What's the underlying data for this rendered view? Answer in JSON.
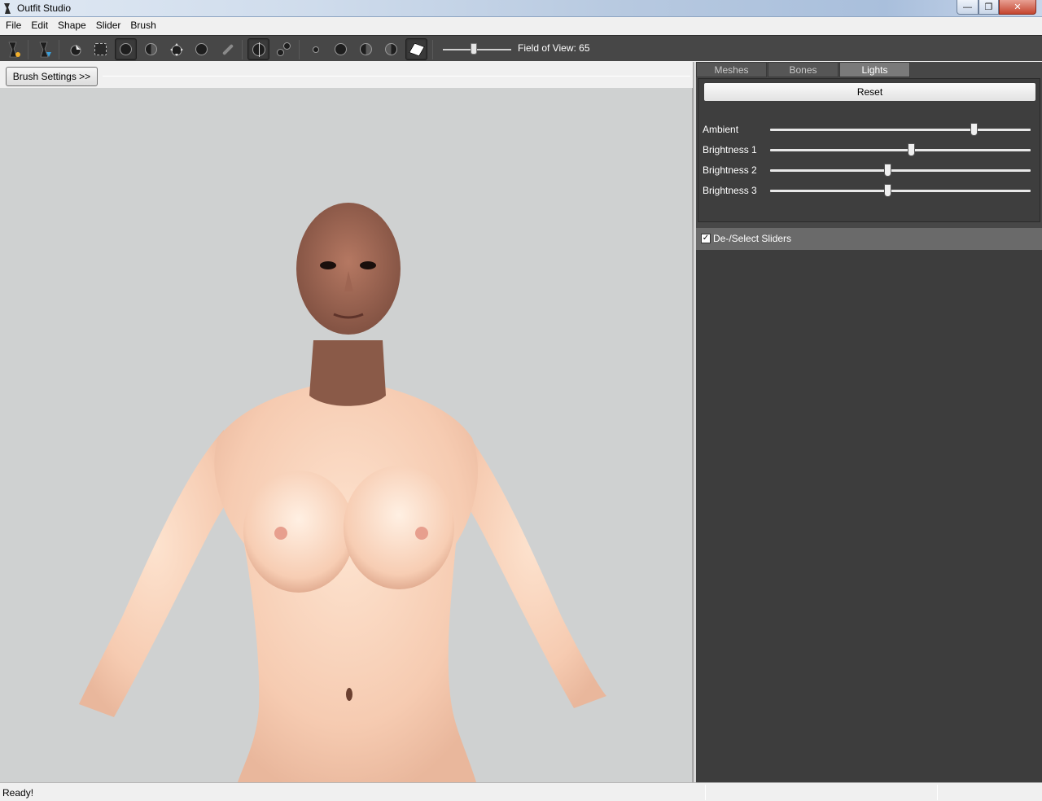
{
  "window": {
    "title": "Outfit Studio",
    "minimize": "—",
    "maximize": "❐",
    "close": "✕"
  },
  "menu": [
    "File",
    "Edit",
    "Shape",
    "Slider",
    "Brush"
  ],
  "toolbar": {
    "fov_label": "Field of View: 65",
    "fov_value": 65,
    "fov_fraction": 0.45
  },
  "brush_settings_label": "Brush Settings >>",
  "right_panel": {
    "tabs": [
      {
        "label": "Meshes",
        "active": false
      },
      {
        "label": "Bones",
        "active": false
      },
      {
        "label": "Lights",
        "active": true
      }
    ],
    "reset_label": "Reset",
    "lights": [
      {
        "label": "Ambient",
        "fraction": 0.79
      },
      {
        "label": "Brightness 1",
        "fraction": 0.545
      },
      {
        "label": "Brightness 2",
        "fraction": 0.45
      },
      {
        "label": "Brightness 3",
        "fraction": 0.45
      }
    ],
    "sliders_checkbox_label": "De-/Select Sliders",
    "sliders_checked": true,
    "checkmark": "✓"
  },
  "status": {
    "text": "Ready!"
  },
  "colors": {
    "toolbar_bg": "#474747",
    "panel_bg": "#3d3d3d",
    "viewport_bg": "#cfd1d1",
    "skin": "#f5cdb4",
    "head": "#a06a55"
  }
}
